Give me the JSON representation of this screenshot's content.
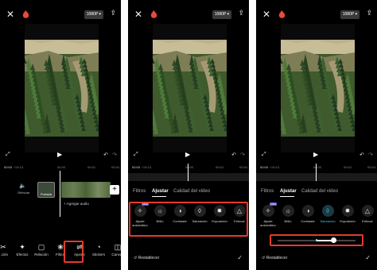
{
  "common": {
    "resolution": "1080P ▾",
    "time_start": "00:00",
    "time_total": "/ 00:13",
    "ruler_marks": [
      "00:00",
      "00:02",
      "00:04"
    ]
  },
  "panel1": {
    "track_mute": "Silenciar",
    "track_cover": "Portada",
    "add_audio": "+ Agregar audio",
    "tools": [
      {
        "icon": "scissors-icon",
        "glyph": "✂",
        "label": "...ción"
      },
      {
        "icon": "sparkle-icon",
        "glyph": "✦",
        "label": "Efectos"
      },
      {
        "icon": "aspect-ratio-icon",
        "glyph": "▢",
        "label": "Relación"
      },
      {
        "icon": "filter-icon",
        "glyph": "❀",
        "label": "Filtros"
      },
      {
        "icon": "adjust-sliders-icon",
        "glyph": "⇌",
        "label": "Ajustar"
      },
      {
        "icon": "sticker-icon",
        "glyph": "◔",
        "label": "Stickers"
      },
      {
        "icon": "canvas-icon",
        "glyph": "◫",
        "label": "Canvas"
      }
    ]
  },
  "adjust": {
    "tabs": [
      "Filtros",
      "Ajustar",
      "Calidad del video"
    ],
    "options": [
      {
        "icon": "magic-wand-icon",
        "glyph": "✧",
        "label": "Ajuste automático",
        "badge": "PRO"
      },
      {
        "icon": "brightness-icon",
        "glyph": "☼",
        "label": "Brillo"
      },
      {
        "icon": "contrast-icon",
        "glyph": "◑",
        "label": "Contraste"
      },
      {
        "icon": "saturation-icon",
        "glyph": "◊",
        "label": "Saturación"
      },
      {
        "icon": "exposure-icon",
        "glyph": "✹",
        "label": "Exposición"
      },
      {
        "icon": "sharpen-icon",
        "glyph": "△",
        "label": "Enfocar"
      }
    ],
    "reset_label": "↺ Restablecer",
    "confirm_glyph": "✓"
  },
  "panel3": {
    "selected_option": "Saturación",
    "saturation_value": 0.72
  },
  "colors": {
    "highlight": "#e53b2c",
    "accent": "#45d0e8",
    "background": "#000000"
  }
}
